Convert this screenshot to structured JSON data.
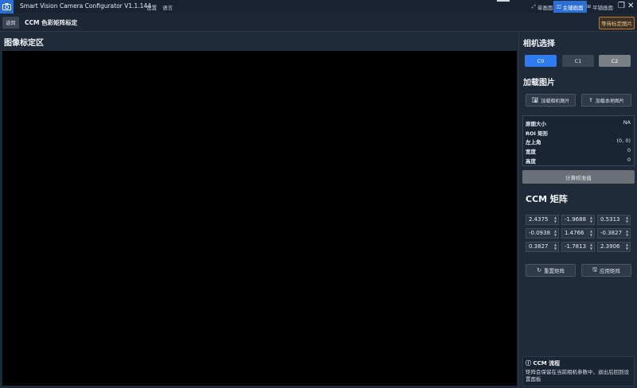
{
  "window": {
    "title": "Smart Vision Camera Configurator V1.1.144",
    "menu": [
      "设置",
      "语言"
    ],
    "view_tabs": [
      {
        "label": "单画面",
        "icon": "expand-icon"
      },
      {
        "label": "主辅画面",
        "icon": "split-view-icon"
      },
      {
        "label": "平铺画面",
        "icon": "grid-icon"
      }
    ],
    "active_tab": "主辅画面"
  },
  "subheader": {
    "back_label": "返回",
    "title": "CCM 色彩矩阵标定",
    "status_label": "等待标定图片",
    "status_color": "#c07a2a"
  },
  "left": {
    "title": "图像标定区"
  },
  "right": {
    "camera_section_title": "相机选择",
    "cameras": [
      {
        "label": "C0",
        "state": "selected"
      },
      {
        "label": "C1",
        "state": "normal"
      },
      {
        "label": "C2",
        "state": "disabled"
      }
    ],
    "load_section_title": "加载图片",
    "load_camera_label": "加载相机图片",
    "load_local_label": "加载本地图片",
    "info": {
      "size_label": "原图大小",
      "size_value": "NA",
      "roi_label": "ROI 矩形",
      "topleft_label": "左上角",
      "topleft_value": "(0, 0)",
      "width_label": "宽度",
      "width_value": "0",
      "height_label": "高度",
      "height_value": "0"
    },
    "calc_label": "计算校准值",
    "ccm_title": "CCM 矩阵",
    "matrix": [
      [
        "2.4375",
        "-1.9688",
        "0.5313"
      ],
      [
        "-0.0938",
        "1.4766",
        "-0.3827"
      ],
      [
        "0.3827",
        "-1.7813",
        "2.3906"
      ]
    ],
    "reset_label": "重置矩阵",
    "apply_label": "应用矩阵",
    "flow_title": "CCM 流程",
    "flow_text": "矩阵会保留在当前相机参数中，退出后回到设置面板"
  },
  "colors": {
    "accent": "#2b6fd6",
    "camera_selected": "#2f7bf0",
    "background": "#1e2a38"
  }
}
